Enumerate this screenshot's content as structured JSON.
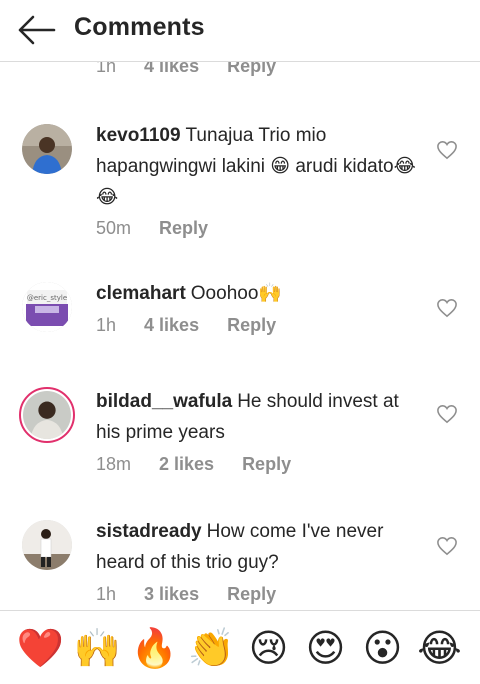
{
  "header": {
    "title": "Comments",
    "back_icon": "arrow-left-icon"
  },
  "partial_comment": {
    "time": "1h",
    "likes": "4 likes",
    "reply": "Reply"
  },
  "comments": [
    {
      "username": "kevo1109",
      "text": "Tunajua Trio mio hapangwingwi lakini 😁 arudi kidato😂😂",
      "time": "50m",
      "likes": "",
      "reply": "Reply"
    },
    {
      "username": "clemahart",
      "text": "Ooohoo🙌",
      "time": "1h",
      "likes": "4 likes",
      "reply": "Reply"
    },
    {
      "username": "bildad__wafula",
      "text": "He should invest at his prime years",
      "time": "18m",
      "likes": "2 likes",
      "reply": "Reply"
    },
    {
      "username": "sistadready",
      "text": "How come I've never heard of this trio guy?",
      "time": "1h",
      "likes": "3 likes",
      "reply": "Reply"
    }
  ],
  "emoji_bar": [
    "❤️",
    "🙌",
    "🔥",
    "👏",
    "😢",
    "😍",
    "😮",
    "😂"
  ],
  "colors": {
    "text": "#262626",
    "secondary": "#8e8e8e",
    "divider": "#dbdbdb",
    "story_ring": "#e1306c"
  }
}
